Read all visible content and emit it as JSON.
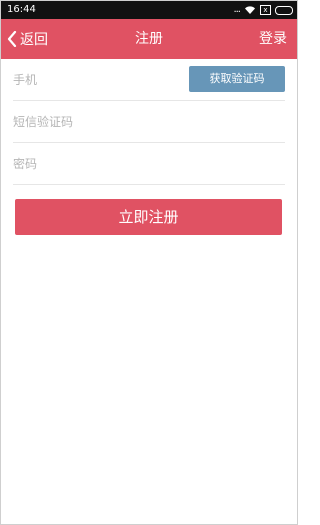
{
  "status_bar": {
    "time": "16:44",
    "signal_dots": "...",
    "sim_label": "x"
  },
  "nav": {
    "back_label": "返回",
    "title": "注册",
    "login_label": "登录",
    "background_color": "#e05263"
  },
  "form": {
    "phone_placeholder": "手机",
    "get_code_label": "获取验证码",
    "sms_code_placeholder": "短信验证码",
    "password_placeholder": "密码",
    "get_code_color": "#6796b8"
  },
  "submit": {
    "label": "立即注册",
    "color": "#e05263"
  }
}
